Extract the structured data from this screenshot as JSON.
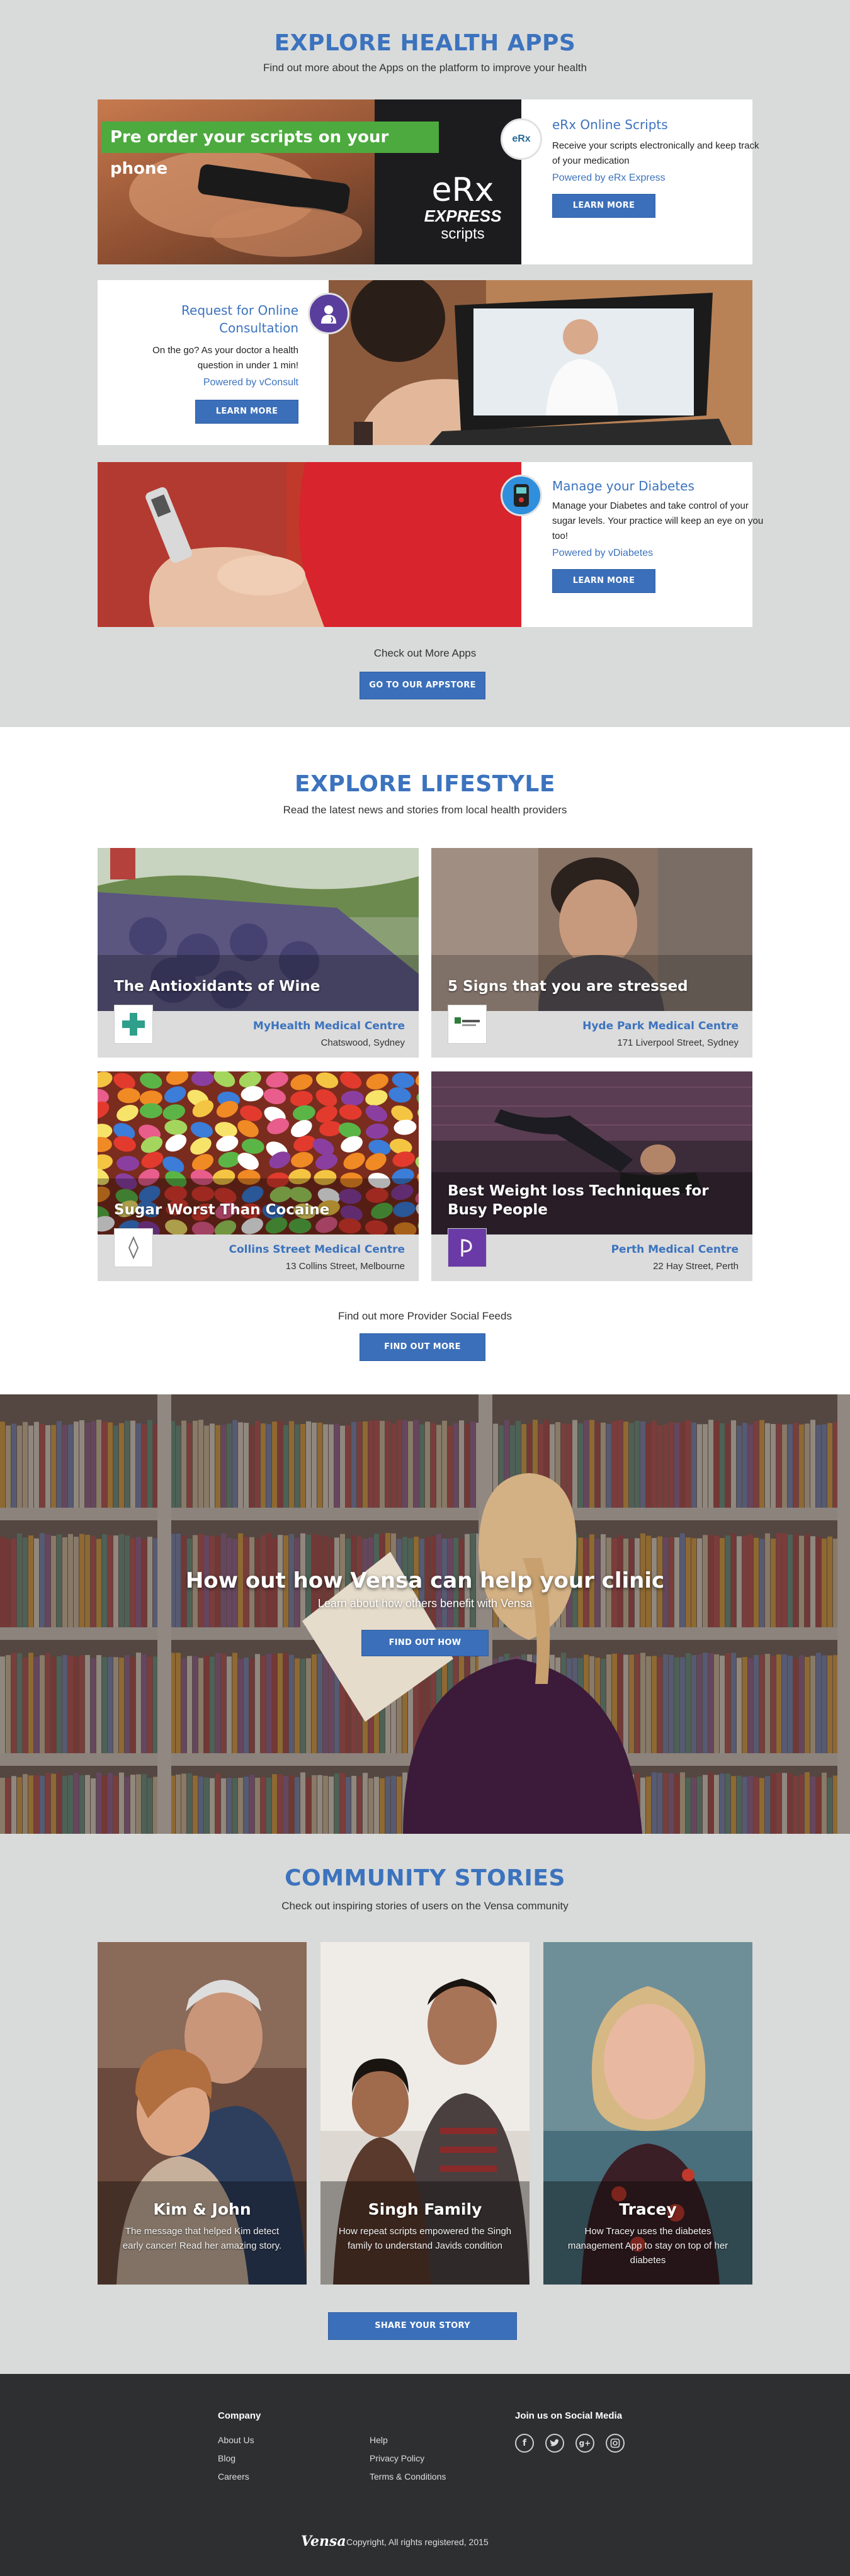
{
  "apps": {
    "title": "EXPLORE HEALTH APPS",
    "subtitle": "Find out more about the Apps on the platform to improve your health",
    "erx": {
      "banner": "Pre order your scripts on your phone",
      "logo_main": "eRx",
      "logo_express": "EXPRESS",
      "logo_scripts": "scripts",
      "badge": "eRx",
      "heading": "eRx Online Scripts",
      "desc": "Receive your scripts electronically and keep track of your medication",
      "powered": "Powered by eRx Express",
      "button": "LEARN MORE"
    },
    "consult": {
      "heading": "Request for Online Consultation",
      "desc": "On the go? As your doctor a health question in under 1 min!",
      "powered": "Powered by vConsult",
      "button": "LEARN MORE"
    },
    "diabetes": {
      "heading": "Manage your Diabetes",
      "desc": "Manage your Diabetes and take control of your sugar levels. Your practice will keep an eye on you too!",
      "powered": "Powered by vDiabetes",
      "button": "LEARN MORE"
    },
    "more_text": "Check out More Apps",
    "appstore_button": "GO TO OUR APPSTORE"
  },
  "lifestyle": {
    "title": "EXPLORE LIFESTYLE",
    "subtitle": "Read the latest news and stories from local health providers",
    "cards": [
      {
        "title": "The Antioxidants of Wine",
        "provider": "MyHealth Medical Centre",
        "address": "Chatswood, Sydney"
      },
      {
        "title": "5 Signs that you are stressed",
        "provider": "Hyde Park Medical Centre",
        "address": "171 Liverpool Street, Sydney"
      },
      {
        "title": "Sugar Worst Than Cocaine",
        "provider": "Collins Street Medical Centre",
        "address": "13 Collins Street, Melbourne"
      },
      {
        "title": "Best Weight loss Techniques for Busy People",
        "provider": "Perth Medical Centre",
        "address": "22 Hay Street, Perth"
      }
    ],
    "more_text": "Find out more Provider Social Feeds",
    "button": "FIND OUT MORE"
  },
  "hero": {
    "title": "How out how Vensa can help your clinic",
    "subtitle": "Learn about how others benefit with Vensa",
    "button": "FIND OUT HOW"
  },
  "community": {
    "title": "COMMUNITY STORIES",
    "subtitle": "Check out inspiring stories of users on the Vensa community",
    "stories": [
      {
        "name": "Kim & John",
        "desc": "The message that helped Kim detect early cancer! Read her amazing story."
      },
      {
        "name": "Singh Family",
        "desc": "How repeat scripts empowered the Singh family to understand Javids condition"
      },
      {
        "name": "Tracey",
        "desc": "How Tracey uses the diabetes management App to stay on top of her diabetes"
      }
    ],
    "button": "SHARE YOUR STORY"
  },
  "footer": {
    "company_heading": "Company",
    "links_col1": [
      "About Us",
      "Blog",
      "Careers"
    ],
    "links_col2": [
      "Help",
      "Privacy Policy",
      "Terms & Conditions"
    ],
    "social_heading": "Join us on Social Media",
    "social": [
      "f",
      "t",
      "g+",
      "ig"
    ],
    "brand": "Vensa",
    "copyright": "Copyright, All rights registered, 2015"
  },
  "colors": {
    "accent": "#3c73be",
    "button": "#3b6fb9",
    "banner_green": "#4daa3f",
    "footer_bg": "#2d2f31",
    "section_gray": "#d9dbda"
  }
}
